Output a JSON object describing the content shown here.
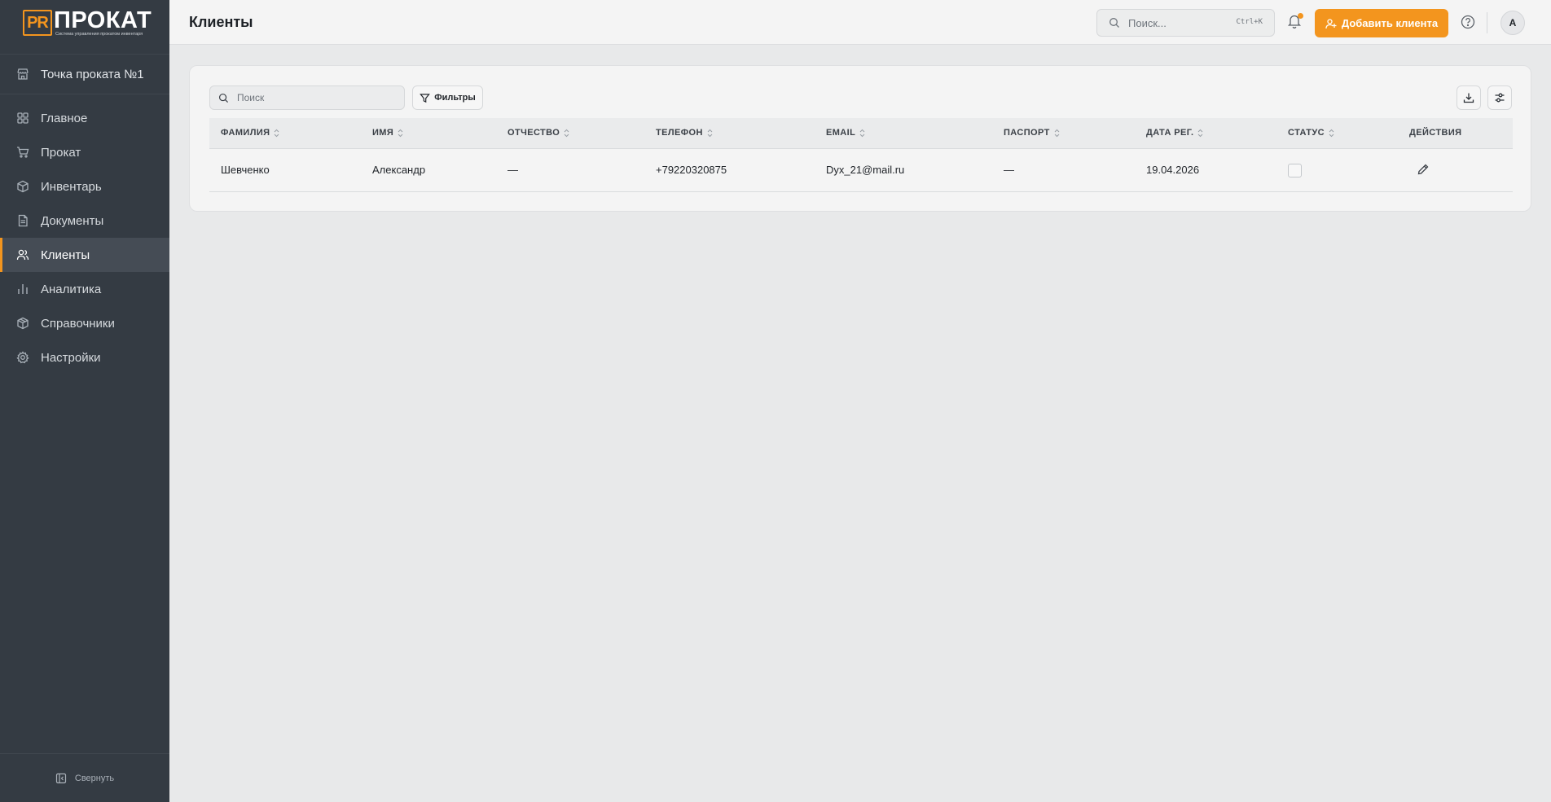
{
  "brand": {
    "mark": "PR",
    "name": "ПРОКАТ",
    "tagline": "Система управления прокатом инвентаря",
    "accent": "#f3951e"
  },
  "sidebar": {
    "point": "Точка проката №1",
    "items": [
      {
        "label": "Главное",
        "icon": "dashboard-grid-icon"
      },
      {
        "label": "Прокат",
        "icon": "cart-icon"
      },
      {
        "label": "Инвентарь",
        "icon": "box-icon"
      },
      {
        "label": "Документы",
        "icon": "document-icon"
      },
      {
        "label": "Клиенты",
        "icon": "users-icon",
        "active": true
      },
      {
        "label": "Аналитика",
        "icon": "bar-chart-icon"
      },
      {
        "label": "Справочники",
        "icon": "catalog-icon"
      },
      {
        "label": "Настройки",
        "icon": "gear-icon"
      }
    ],
    "collapse": "Свернуть"
  },
  "header": {
    "title": "Клиенты",
    "search_placeholder": "Поиск...",
    "search_shortcut": "Ctrl+K",
    "add_button": "Добавить клиента",
    "avatar": "A"
  },
  "toolbar": {
    "search_placeholder": "Поиск",
    "filters": "Фильтры"
  },
  "table": {
    "columns": [
      "ФАМИЛИЯ",
      "ИМЯ",
      "ОТЧЕСТВО",
      "ТЕЛЕФОН",
      "EMAIL",
      "ПАСПОРТ",
      "ДАТА РЕГ.",
      "СТАТУС",
      "ДЕЙСТВИЯ"
    ],
    "rows": [
      {
        "last_name": "Шевченко",
        "first_name": "Александр",
        "middle_name": "—",
        "phone": "+79220320875",
        "email": "Dyx_21@mail.ru",
        "passport": "—",
        "reg_date": "19.04.2026",
        "status_checked": false
      }
    ]
  }
}
